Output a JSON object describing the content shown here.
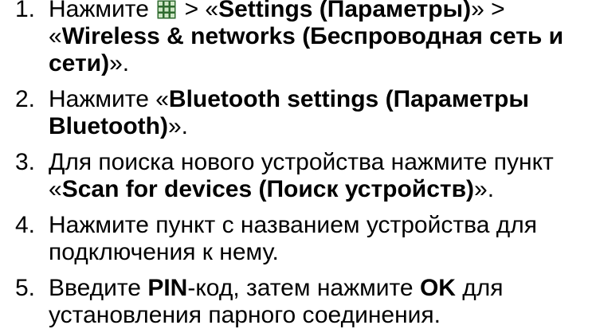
{
  "steps": [
    {
      "number": "1.",
      "lines": [
        {
          "a": "Нажмите ",
          "icon": "grid-menu-icon",
          "b": " > «",
          "c": "Settings (Параметры)",
          "d": "» >"
        },
        {
          "a": "«",
          "b": "Wireless & networks (Беспроводная сеть и",
          "c": ""
        },
        {
          "a": "",
          "b": "сети)",
          "c": "»."
        }
      ]
    },
    {
      "number": "2.",
      "lines": [
        {
          "a": "Нажмите «",
          "b": "Bluetooth settings (Параметры",
          "c": ""
        },
        {
          "a": "",
          "b": "Bluetooth)",
          "c": "»."
        }
      ]
    },
    {
      "number": "3.",
      "lines": [
        {
          "text": "Для поиска нового устройства нажмите пункт"
        },
        {
          "a": "«",
          "b": "Scan for devices (Поиск устройств)",
          "c": "»."
        }
      ]
    },
    {
      "number": "4.",
      "lines": [
        {
          "text": "Нажмите пункт с названием устройства для"
        },
        {
          "text": "подключения к нему."
        }
      ]
    },
    {
      "number": "5.",
      "lines": [
        {
          "a": "Введите ",
          "b": "PIN",
          "c": "-код, затем нажмите ",
          "d": "OK",
          "e": " для"
        },
        {
          "text": "установления парного соединения."
        }
      ]
    }
  ]
}
